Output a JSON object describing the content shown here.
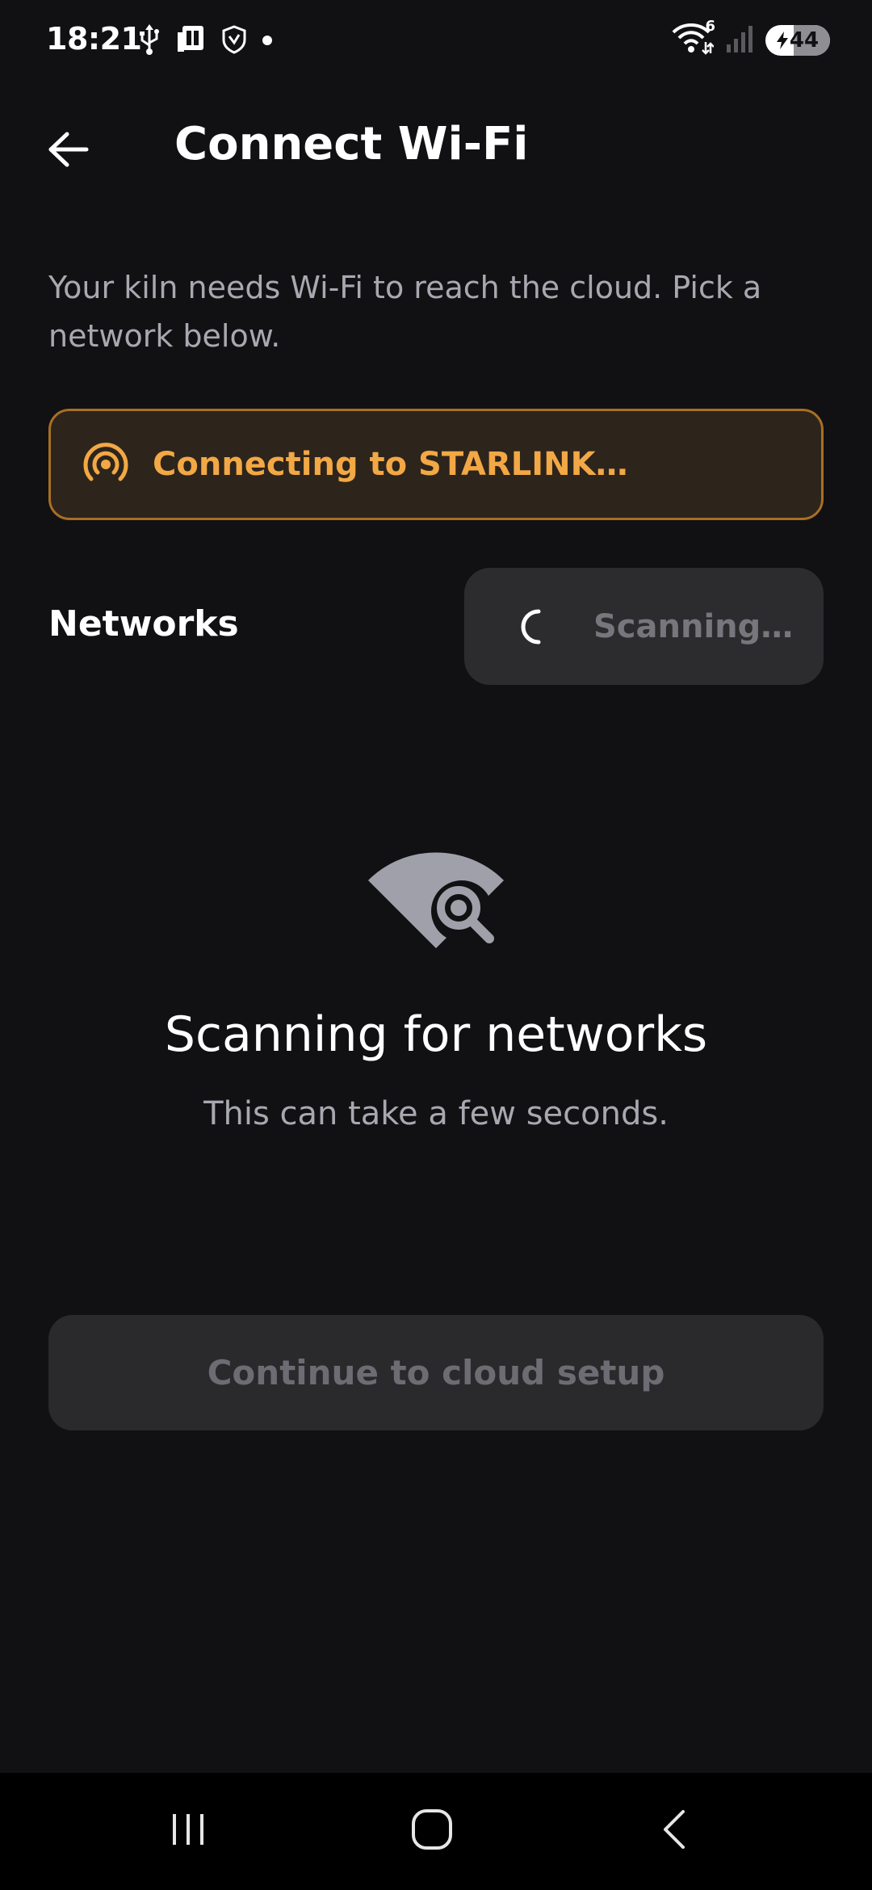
{
  "status_bar": {
    "time": "18:21",
    "left_icons": [
      "usb-icon",
      "sim-card-icon",
      "shield-icon",
      "notification-dot-icon"
    ],
    "wifi_badge": "6",
    "battery_level": "44"
  },
  "header": {
    "title": "Connect Wi-Fi"
  },
  "description": "Your kiln needs Wi-Fi to reach the cloud. Pick a network below.",
  "connecting_banner": {
    "text": "Connecting to STARLINK…",
    "accent_color": "#f2a844"
  },
  "networks": {
    "label": "Networks",
    "scan_button_label": "Scanning…"
  },
  "empty_state": {
    "title": "Scanning for networks",
    "subtitle": "This can take a few seconds."
  },
  "continue_button_label": "Continue to cloud setup",
  "nav_bar": {
    "items": [
      "recent-apps-icon",
      "home-icon",
      "back-icon"
    ]
  }
}
